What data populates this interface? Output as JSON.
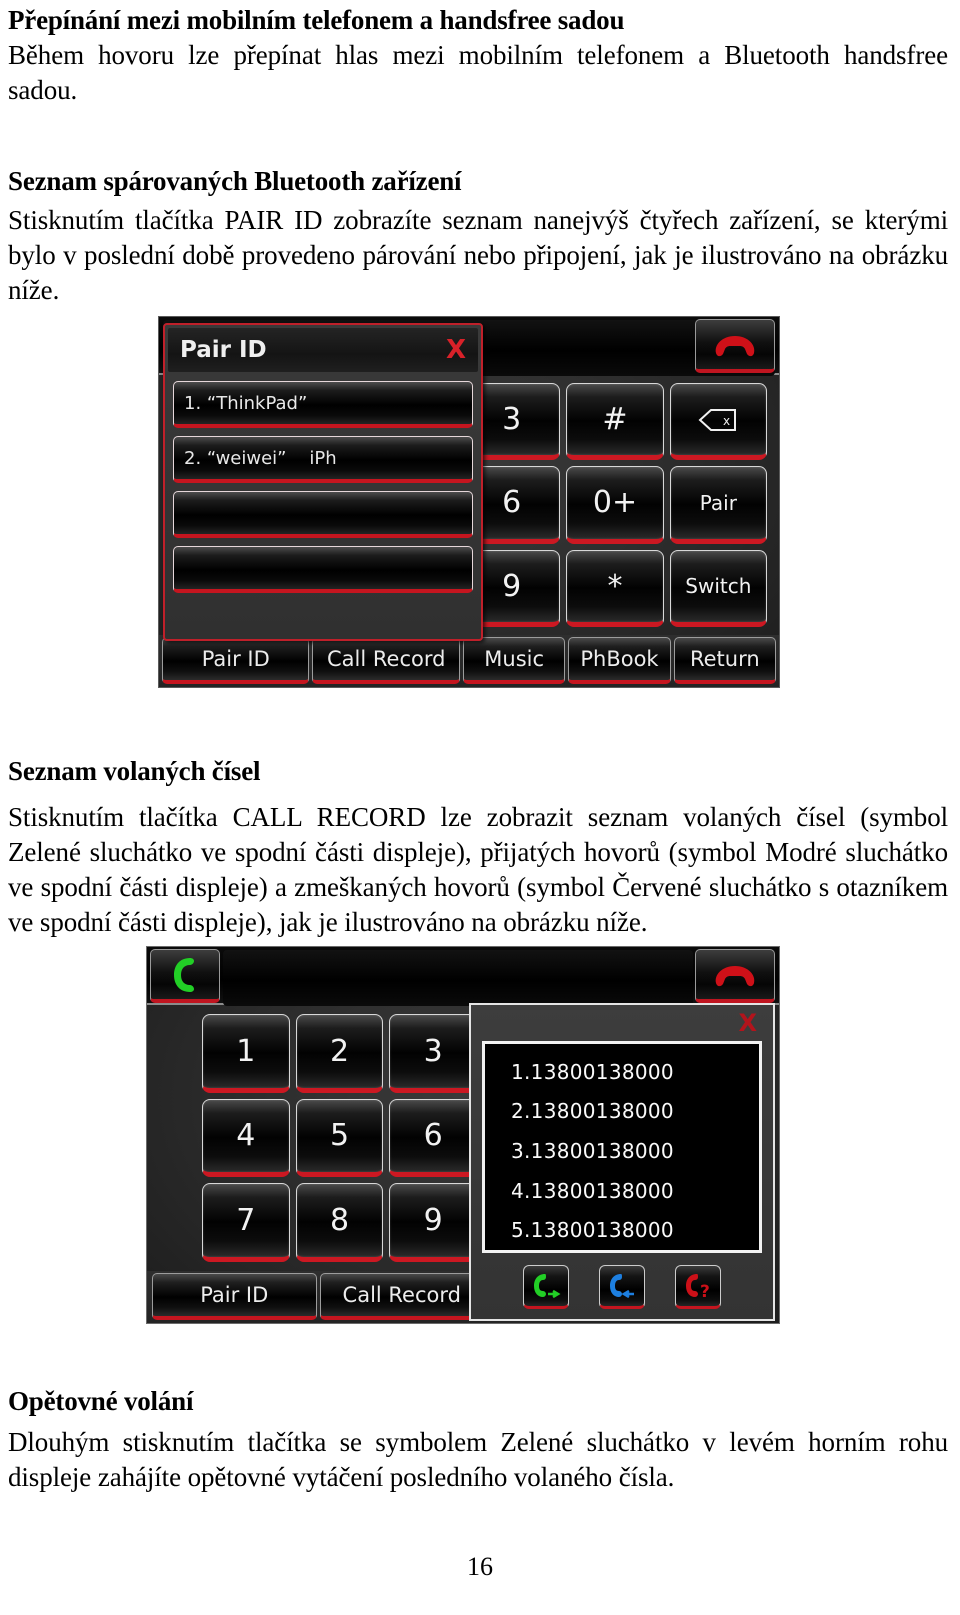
{
  "document": {
    "page_number": "16",
    "sections": [
      {
        "heading": "Přepínání mezi mobilním telefonem a handsfree sadou",
        "paragraph": "Během hovoru lze přepínat hlas mezi mobilním telefonem a Bluetooth handsfree sadou."
      },
      {
        "heading": "Seznam spárovaných Bluetooth zařízení",
        "paragraph": "Stisknutím tlačítka PAIR ID zobrazíte seznam nanejvýš čtyřech zařízení, se kterými bylo v poslední době provedeno párování nebo připojení, jak je ilustrováno na obrázku níže."
      },
      {
        "heading": "Seznam volaných čísel",
        "paragraph": "Stisknutím tlačítka CALL RECORD lze zobrazit seznam volaných čísel (symbol Zelené sluchátko ve spodní části displeje), přijatých hovorů (symbol Modré sluchátko ve spodní části displeje) a zmeškaných hovorů (symbol Červené sluchátko s otazníkem ve spodní části displeje), jak je ilustrováno na obrázku níže."
      },
      {
        "heading": "Opětovné volání",
        "paragraph": "Dlouhým stisknutím tlačítka se symbolem Zelené sluchátko v levém horním rohu displeje zahájíte opětovné vytáčení posledního volaného čísla."
      }
    ]
  },
  "figure_pair_id": {
    "caption_context": "Bluetooth handsfree head unit showing the Pair ID device list dialog",
    "dialog": {
      "title": "Pair ID",
      "close_label": "X",
      "items": [
        {
          "label": "1. “ThinkPad”"
        },
        {
          "label": "2. “weiwei”    iPh"
        },
        {
          "label": ""
        },
        {
          "label": ""
        }
      ]
    },
    "keypad": [
      {
        "label": "3",
        "partial": true
      },
      {
        "label": "#",
        "partial": false
      },
      {
        "label": "del-icon",
        "partial": false
      },
      {
        "label": "6",
        "partial": true
      },
      {
        "label": "0+",
        "partial": false
      },
      {
        "label": "Pair",
        "partial": false
      },
      {
        "label": "9",
        "partial": true
      },
      {
        "label": "*",
        "partial": false
      },
      {
        "label": "Switch",
        "partial": false
      }
    ],
    "tabs": [
      "Pair ID",
      "Call Record",
      "Music",
      "PhBook",
      "Return"
    ],
    "hangup_icon": "red-hangup-phone-icon"
  },
  "figure_call_record": {
    "caption_context": "Bluetooth handsfree head unit showing the Call Record list dialog",
    "pickup_icon": "green-phone-icon",
    "hangup_icon": "red-hangup-phone-icon",
    "keypad": [
      "1",
      "2",
      "3",
      "4",
      "5",
      "6",
      "7",
      "8",
      "9"
    ],
    "tabs": [
      "Pair ID",
      "Call Record"
    ],
    "dialog": {
      "close_label": "X",
      "numbers": [
        "1.13800138000",
        "2.13800138000",
        "3.13800138000",
        "4.13800138000",
        "5.13800138000"
      ],
      "icons": [
        {
          "name": "outgoing-call-icon",
          "color": "#27c42b"
        },
        {
          "name": "incoming-call-icon",
          "color": "#1d7fe0"
        },
        {
          "name": "missed-call-icon",
          "color": "#cc1018"
        }
      ]
    }
  },
  "colors": {
    "accent_red": "#c5151f",
    "panel_dark": "#2b2b2b",
    "text_light": "#efefef",
    "green": "#27c42b",
    "blue": "#1d7fe0",
    "red": "#cc1018"
  }
}
